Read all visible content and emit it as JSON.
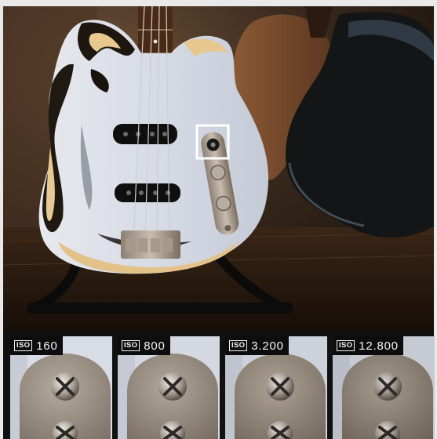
{
  "hero": {
    "subject_icon": "bass-guitar-photo",
    "highlight_icon": "zoom-region-marker"
  },
  "iso_crops": [
    {
      "iso_label": "ISO",
      "iso_value": "160"
    },
    {
      "iso_label": "ISO",
      "iso_value": "800"
    },
    {
      "iso_label": "ISO",
      "iso_value": "3.200"
    },
    {
      "iso_label": "ISO",
      "iso_value": "12.800"
    }
  ],
  "colors": {
    "background": "#e9e9e9",
    "strip": "#111111",
    "guitar_body": "#d9dde6",
    "marker": "#ffffff"
  }
}
